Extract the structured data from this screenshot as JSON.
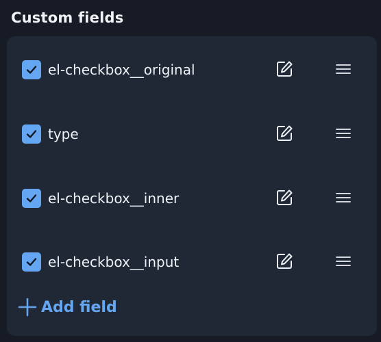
{
  "section": {
    "title": "Custom fields"
  },
  "fields": [
    {
      "label": "el-checkbox__original",
      "checked": true,
      "checkbox_icon": "checkmark-icon",
      "edit_icon": "edit-icon",
      "drag_icon": "drag-handle-icon"
    },
    {
      "label": "type",
      "checked": true,
      "checkbox_icon": "checkmark-icon",
      "edit_icon": "edit-icon",
      "drag_icon": "drag-handle-icon"
    },
    {
      "label": "el-checkbox__inner",
      "checked": true,
      "checkbox_icon": "checkmark-icon",
      "edit_icon": "edit-icon",
      "drag_icon": "drag-handle-icon"
    },
    {
      "label": "el-checkbox__input",
      "checked": true,
      "checkbox_icon": "checkmark-icon",
      "edit_icon": "edit-icon",
      "drag_icon": "drag-handle-icon"
    }
  ],
  "add_field": {
    "label": "Add field",
    "icon": "plus-icon"
  },
  "colors": {
    "background": "#161b25",
    "panel": "#202835",
    "accent": "#64a6f2",
    "text": "#eef1f6"
  }
}
